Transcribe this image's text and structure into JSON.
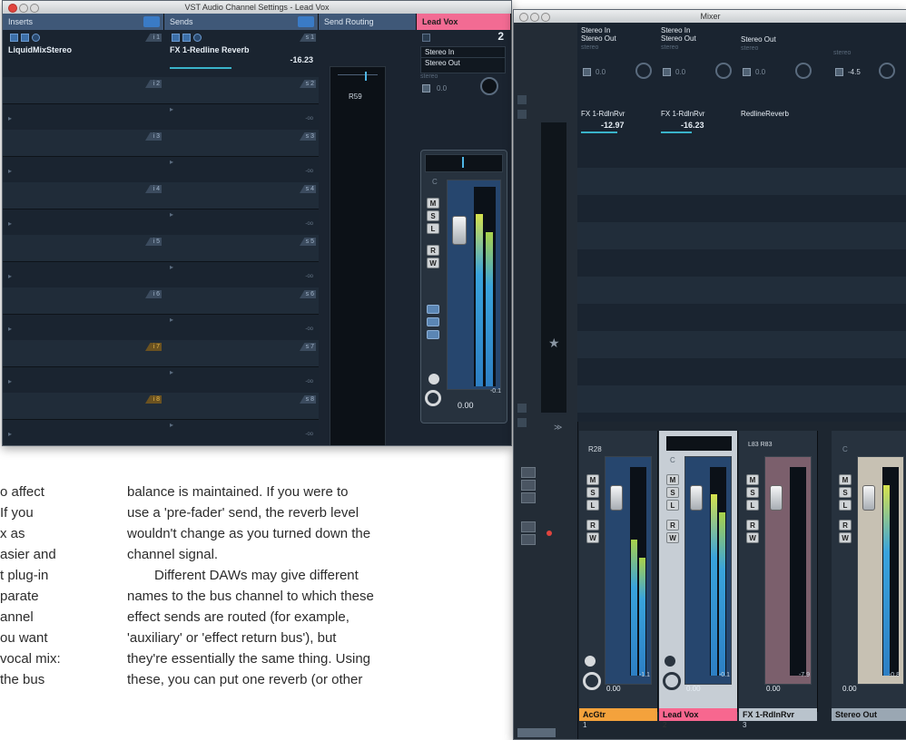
{
  "channel_settings_window": {
    "title": "VST Audio Channel Settings - Lead Vox",
    "sections": {
      "inserts": "Inserts",
      "sends": "Sends",
      "send_routing": "Send Routing",
      "channel_name": "Lead Vox"
    },
    "inserts_slot1": "LiquidMixStereo",
    "sends_slot1": "FX 1-Redline Reverb",
    "sends_slot1_level": "-16.23",
    "slot_numbers": [
      "i 1",
      "i 2",
      "i 3",
      "i 4",
      "i 5",
      "i 6",
      "i 7",
      "i 8"
    ],
    "send_numbers": [
      "s 1",
      "s 2",
      "s 3",
      "s 4",
      "s 5",
      "s 6",
      "s 7",
      "s 8"
    ],
    "send_inf": "-oo",
    "routing_pan": "R59",
    "channel_number": "2",
    "io": {
      "input": "Stereo In",
      "output": "Stereo Out",
      "config": "stereo"
    },
    "channel_pan_value": "0.0",
    "pan_label": "C",
    "buttons": [
      "M",
      "S",
      "L",
      "R",
      "W"
    ],
    "fader_peak": "-0.1",
    "fader_value": "0.00"
  },
  "mixer_window": {
    "title": "Mixer",
    "top_strips": [
      {
        "input": "Stereo In",
        "output": "Stereo Out",
        "config": "stereo",
        "pan": "0.0",
        "send_name": "FX 1-RdlnRvr",
        "send_level": "-12.97"
      },
      {
        "input": "Stereo In",
        "output": "Stereo Out",
        "config": "stereo",
        "pan": "0.0",
        "send_name": "FX 1-RdlnRvr",
        "send_level": "-16.23"
      },
      {
        "input": "",
        "output": "Stereo Out",
        "config": "stereo",
        "pan": "0.0",
        "send_name": "RedlineReverb",
        "send_level": ""
      },
      {
        "input": "",
        "output": "",
        "config": "stereo",
        "pan": "-4.5",
        "send_name": "",
        "send_level": ""
      }
    ],
    "strips": [
      {
        "name": "AcGtr",
        "number": "1",
        "pan": "R28",
        "peak": "-1.1",
        "value": "0.00",
        "color": "#f4a23c"
      },
      {
        "name": "Lead Vox",
        "number": "2",
        "pan": "C",
        "peak": "-0.1",
        "value": "0.00",
        "color": "#f7678f"
      },
      {
        "name": "FX 1-RdlnRvr",
        "number": "3",
        "pan": "L83 R83",
        "peak": "-7.9",
        "value": "0.00",
        "color": "#b9c3cc"
      },
      {
        "name": "Stereo Out",
        "number": "",
        "pan": "C",
        "peak": "-0.8",
        "value": "0.00",
        "color": "#9aa7b3"
      }
    ]
  },
  "article_text": {
    "left_fragments": [
      "o affect",
      "If you",
      "x as",
      "asier and",
      "t plug-in",
      "parate",
      "annel",
      "ou want",
      "vocal mix:",
      "the bus"
    ],
    "main_lines": [
      "balance is maintained. If you were to",
      "use a 'pre-fader' send, the reverb level",
      "wouldn't change as you turned down the",
      "channel signal.",
      "Different DAWs may give different",
      "names to the bus channel to which these",
      "effect sends are routed (for example,",
      "'auxiliary' or 'effect return bus'), but",
      "they're essentially the same thing. Using",
      "these, you can put one reverb (or other"
    ]
  }
}
